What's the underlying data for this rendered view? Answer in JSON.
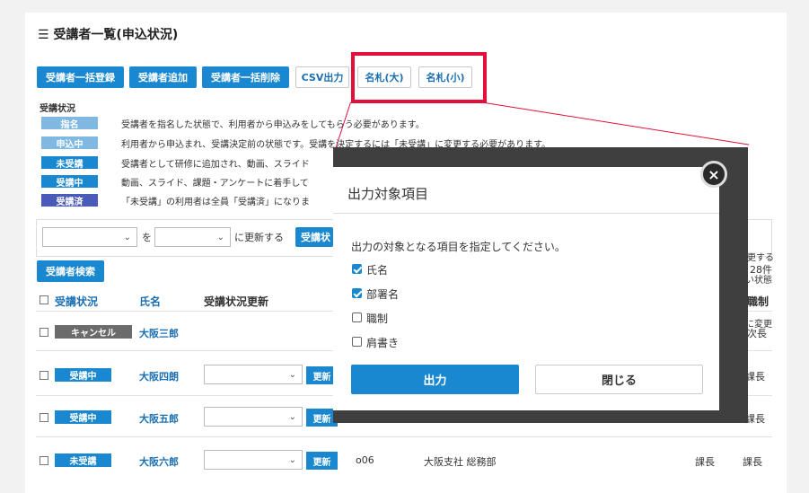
{
  "page": {
    "title": "受講者一覧(申込状況)"
  },
  "toolbar": {
    "bulk_register": "受講者一括登録",
    "add_student": "受講者追加",
    "bulk_delete": "受講者一括削除",
    "csv_export": "CSV出力",
    "nameplate_large": "名札(大)",
    "nameplate_small": "名札(小)"
  },
  "legend": {
    "heading": "受講状況",
    "items": [
      {
        "label": "指名",
        "color": "#7fb9e2",
        "desc": "受講者を指名した状態で、利用者から申込みをしてもらう必要があります。"
      },
      {
        "label": "申込中",
        "color": "#7fb9e2",
        "desc": "利用者から申込まれ、受講決定前の状態です。受講を決定するには「未受講」に変更する必要があります。"
      },
      {
        "label": "未受講",
        "color": "#1a88d0",
        "desc": "受講者として研修に追加され、動画、スライド"
      },
      {
        "label": "受講中",
        "color": "#1a88d0",
        "desc": "動画、スライド、課題・アンケートに着手して"
      },
      {
        "label": "受講済",
        "color": "#4a5ab8",
        "desc": "「未受講」の利用者は全員「受講済」になりま"
      }
    ]
  },
  "bulk_update": {
    "wo": "を",
    "update_to": "に更新する",
    "update_button": "受講状"
  },
  "search_button": "受講者検索",
  "right_fragments": {
    "update_hint": "更する",
    "count": "28件",
    "state_hint": "い状態",
    "change_hint": "に変更"
  },
  "table": {
    "headers": {
      "status": "受講状況",
      "name": "氏名",
      "status_update": "受講状況更新",
      "position": "職制"
    },
    "update_label": "更新",
    "rows": [
      {
        "status": "キャンセル",
        "status_color": "#6b6b6b",
        "name": "大阪三郎",
        "has_select": false,
        "id": "",
        "dept": "",
        "pos1": "",
        "pos2": "次長"
      },
      {
        "status": "受講中",
        "status_color": "#1a88d0",
        "name": "大阪四朗",
        "has_select": true,
        "id": "",
        "dept": "",
        "pos1": "",
        "pos2": "課長"
      },
      {
        "status": "受講中",
        "status_color": "#1a88d0",
        "name": "大阪五郎",
        "has_select": true,
        "id": "",
        "dept": "",
        "pos1": "",
        "pos2": "課長"
      },
      {
        "status": "未受講",
        "status_color": "#1a88d0",
        "name": "大阪六郎",
        "has_select": true,
        "id": "o06",
        "dept": "大阪支社 総務部",
        "pos1": "課長",
        "pos2": "課長"
      }
    ]
  },
  "modal": {
    "title": "出力対象項目",
    "instruction": "出力の対象となる項目を指定してください。",
    "options": [
      {
        "label": "氏名",
        "checked": true
      },
      {
        "label": "部署名",
        "checked": true
      },
      {
        "label": "職制",
        "checked": false
      },
      {
        "label": "肩書き",
        "checked": false
      }
    ],
    "output_button": "出力",
    "close_button": "閉じる",
    "close_icon": "×"
  }
}
